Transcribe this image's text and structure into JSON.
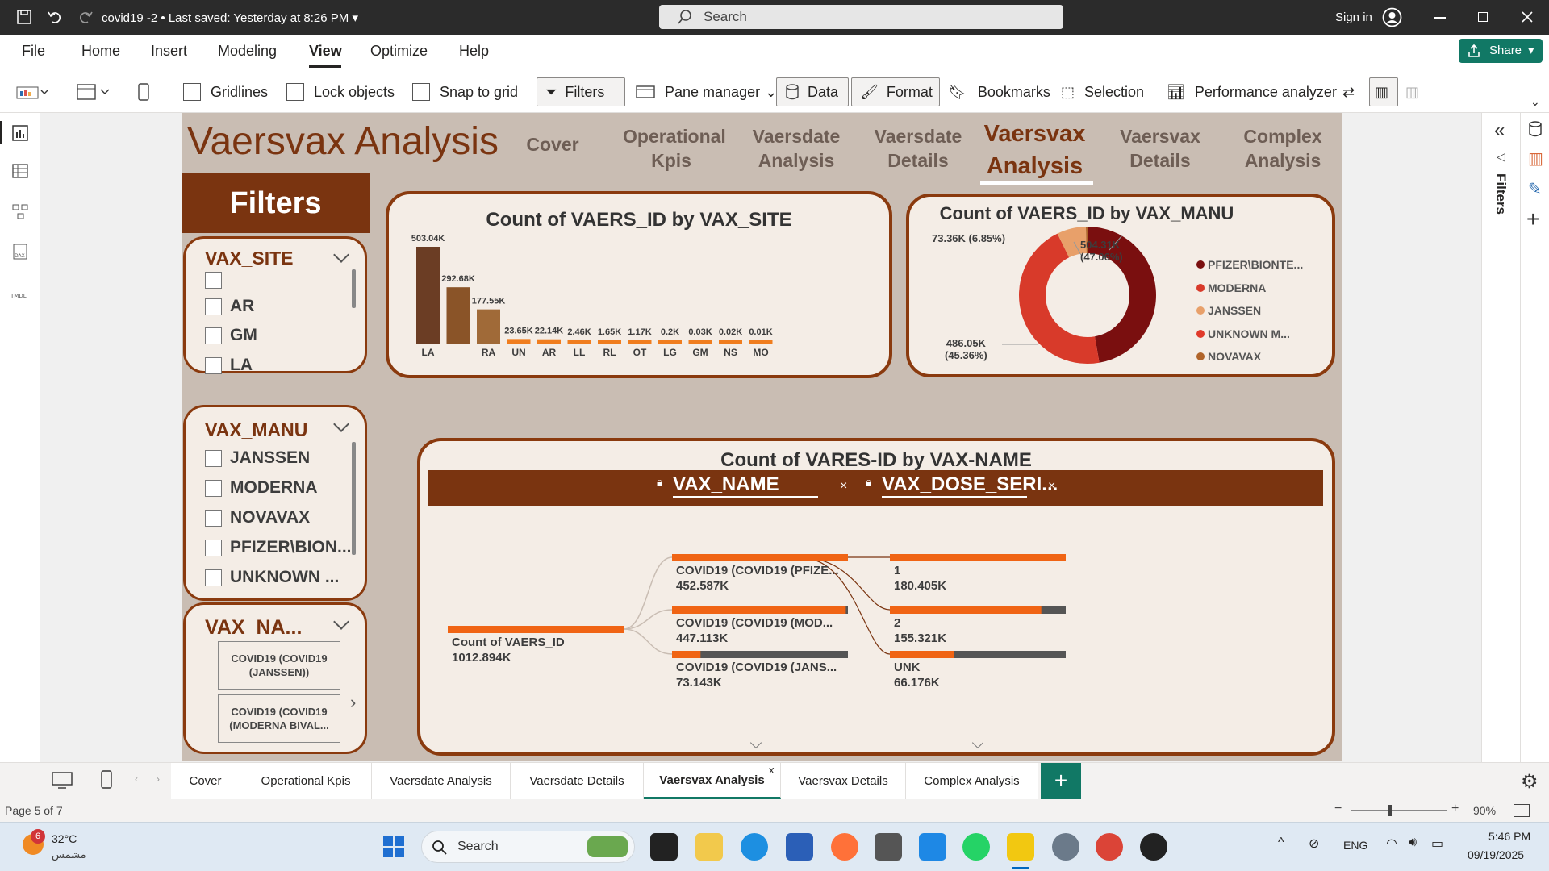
{
  "titlebar": {
    "filename": "covid19 -2",
    "saved": "Last saved: Yesterday at 8:26 PM",
    "search_placeholder": "Search",
    "signin": "Sign in"
  },
  "menu": {
    "items": [
      "File",
      "Home",
      "Insert",
      "Modeling",
      "View",
      "Optimize",
      "Help"
    ],
    "active": "View",
    "share": "Share"
  },
  "ribbon": {
    "gridlines": "Gridlines",
    "lock_objects": "Lock objects",
    "snap_to_grid": "Snap to grid",
    "filters": "Filters",
    "pane_manager": "Pane manager",
    "data": "Data",
    "format": "Format",
    "bookmarks": "Bookmarks",
    "selection": "Selection",
    "performance": "Performance analyzer"
  },
  "report": {
    "title": "Vaersvax Analysis",
    "nav": [
      {
        "label": "Cover"
      },
      {
        "label": "Operational Kpis"
      },
      {
        "label": "Vaersdate Analysis"
      },
      {
        "label": "Vaersdate Details"
      },
      {
        "label": "Vaersvax Analysis",
        "active": true
      },
      {
        "label": "Vaersvax Details"
      },
      {
        "label": "Complex Analysis"
      }
    ],
    "filters_heading": "Filters",
    "slicers": {
      "site": {
        "title": "VAX_SITE",
        "items": [
          "",
          "AR",
          "GM",
          "LA"
        ]
      },
      "manu": {
        "title": "VAX_MANU",
        "items": [
          "JANSSEN",
          "MODERNA",
          "NOVAVAX",
          "PFIZER\\BION...",
          "UNKNOWN ..."
        ]
      },
      "name": {
        "title": "VAX_NA...",
        "tiles": [
          "COVID19 (COVID19 (JANSSEN))",
          "COVID19 (COVID19 (MODERNA BIVAL..."
        ]
      }
    },
    "bar_title": "Count of VAERS_ID by VAX_SITE",
    "donut_title": "Count of VAERS_ID by VAX_MANU",
    "donut_labels": {
      "pfizer_val": "504.31K",
      "pfizer_pct": "(47.06%)",
      "moderna_val": "486.05K",
      "moderna_pct": "(45.36%)",
      "janssen": "73.36K (6.85%)"
    },
    "tree_title": "Count of VARES-ID by VAX-NAME",
    "tree_headers": [
      "VAX_NAME",
      "VAX_DOSE_SERI..."
    ],
    "tree_root": {
      "label": "Count of VAERS_ID",
      "value": "1012.894K"
    },
    "tree_level1": [
      {
        "label": "COVID19 (COVID19 (PFIZE...",
        "value": "452.587K",
        "fraction": 1.0
      },
      {
        "label": "COVID19 (COVID19 (MOD...",
        "value": "447.113K",
        "fraction": 0.988
      },
      {
        "label": "COVID19 (COVID19 (JANS...",
        "value": "73.143K",
        "fraction": 0.162
      }
    ],
    "tree_level2": [
      {
        "label": "1",
        "value": "180.405K",
        "fraction": 1.0
      },
      {
        "label": "2",
        "value": "155.321K",
        "fraction": 0.861
      },
      {
        "label": "UNK",
        "value": "66.176K",
        "fraction": 0.367
      }
    ]
  },
  "chart_data": [
    {
      "type": "bar",
      "title": "Count of VAERS_ID by VAX_SITE",
      "categories": [
        "LA",
        "",
        "RA",
        "UN",
        "AR",
        "LL",
        "RL",
        "OT",
        "LG",
        "GM",
        "NS",
        "MO"
      ],
      "values": [
        503.04,
        292.68,
        177.55,
        23.65,
        22.14,
        2.46,
        1.65,
        1.17,
        0.2,
        0.03,
        0.02,
        0.01
      ],
      "value_labels": [
        "503.04K",
        "292.68K",
        "177.55K",
        "23.65K",
        "22.14K",
        "2.46K",
        "1.65K",
        "1.17K",
        "0.2K",
        "0.03K",
        "0.02K",
        "0.01K"
      ],
      "colors": [
        "#6b3d24",
        "#8a5428",
        "#a06a38",
        "#f07d1e",
        "#f07d1e",
        "#f07d1e",
        "#f07d1e",
        "#f07d1e",
        "#f07d1e",
        "#f07d1e",
        "#f07d1e",
        "#f07d1e"
      ]
    },
    {
      "type": "pie",
      "title": "Count of VAERS_ID by VAX_MANU",
      "legend": [
        "PFIZER\\BIONTE...",
        "MODERNA",
        "JANSSEN",
        "UNKNOWN M...",
        "NOVAVAX"
      ],
      "legend_colors": [
        "#7a0f0f",
        "#d83a2a",
        "#e8a06a",
        "#e03a2a",
        "#b0642a"
      ],
      "slices": [
        {
          "name": "PFIZER\\BIONTE...",
          "value": 504.31,
          "color": "#7a0f0f"
        },
        {
          "name": "MODERNA",
          "value": 486.05,
          "color": "#d83a2a"
        },
        {
          "name": "JANSSEN",
          "value": 73.36,
          "color": "#e8a06a"
        },
        {
          "name": "NOVAVAX",
          "value": 4.0,
          "color": "#b0642a"
        }
      ]
    }
  ],
  "tabs": [
    "Cover",
    "Operational Kpis",
    "Vaersdate Analysis",
    "Vaersdate Details",
    "Vaersvax Analysis",
    "Vaersvax Details",
    "Complex Analysis"
  ],
  "active_tab": "Vaersvax Analysis",
  "status": {
    "page": "Page 5 of 7",
    "zoom": "90%"
  },
  "taskbar": {
    "temp": "32°C",
    "weather": "مشمس",
    "badge": "6",
    "search": "Search",
    "lang": "ENG",
    "time": "5:46 PM",
    "date": "09/19/2025"
  },
  "right_pane": {
    "filters_label": "Filters"
  },
  "colors": {
    "accent": "#8a3a0e",
    "brand": "#117865"
  }
}
